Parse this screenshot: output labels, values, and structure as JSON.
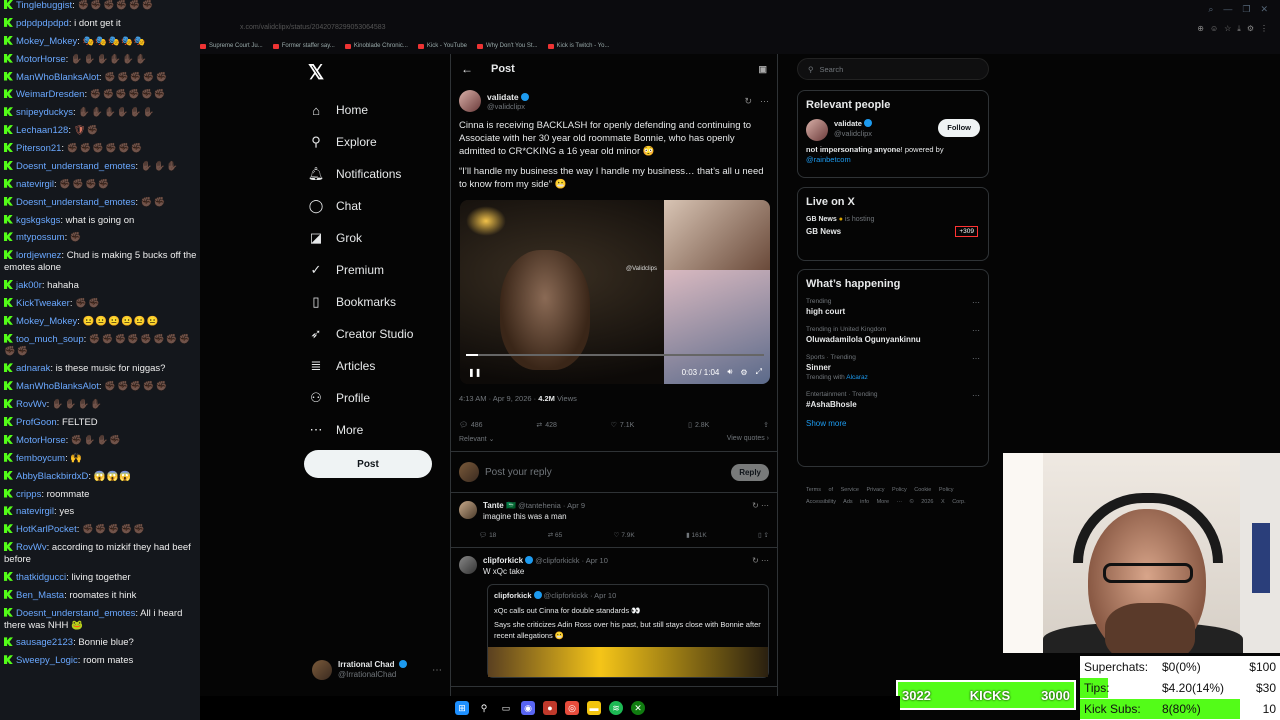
{
  "chat": {
    "messages": [
      {
        "user": "Tinglebuggist",
        "text": "",
        "emotes": "✊🏿✊🏿✊🏿✊🏿✊🏿✊🏿"
      },
      {
        "user": "pdpdpdpdpd",
        "text": "i dont get it",
        "emotes": ""
      },
      {
        "user": "Mokey_Mokey",
        "text": "",
        "emotes": "🎭🎭🎭🎭🎭"
      },
      {
        "user": "MotorHorse",
        "text": "",
        "emotes": "✋🏿✋🏿✋🏿✋🏿✋🏿✋🏿"
      },
      {
        "user": "ManWhoBlanksAlot",
        "text": "",
        "emotes": "✊🏿✊🏿✊🏿✊🏿✊🏿"
      },
      {
        "user": "WeimarDresden",
        "text": "",
        "emotes": "✊🏿✊🏿✊🏿✊🏿✊🏿✊🏿"
      },
      {
        "user": "snipeyduckys",
        "text": "",
        "emotes": "✋🏿✋🏿✋🏿✋🏿✋🏿✋🏿"
      },
      {
        "user": "Lechaan128",
        "text": "",
        "emotes": "🛡✊🏿"
      },
      {
        "user": "Piterson21",
        "text": "",
        "emotes": "✊🏿✊🏿✊🏿✊🏿✊🏿✊🏿"
      },
      {
        "user": "Doesnt_understand_emotes",
        "text": "",
        "emotes": "✋🏿✋🏿✋🏿"
      },
      {
        "user": "natevirgil",
        "text": "",
        "emotes": "✊🏿✊🏿✊🏿✊🏿"
      },
      {
        "user": "Doesnt_understand_emotes",
        "text": "",
        "emotes": "✊🏿✊🏿"
      },
      {
        "user": "kgskgskgs",
        "text": "what is going on",
        "emotes": ""
      },
      {
        "user": "mtypossum",
        "text": "",
        "emotes": "✊🏿"
      },
      {
        "user": "lordjewnez",
        "text": "Chud is making 5 bucks off the emotes alone",
        "emotes": ""
      },
      {
        "user": "jak00r",
        "text": "hahaha",
        "emotes": ""
      },
      {
        "user": "KickTweaker",
        "text": "",
        "emotes": "✊🏿✊🏿"
      },
      {
        "user": "Mokey_Mokey",
        "text": "",
        "emotes": "😐😐😐😐😐😐"
      },
      {
        "user": "too_much_soup",
        "text": "",
        "emotes": "✊🏿✊🏿✊🏿✊🏿✊🏿✊🏿✊🏿✊🏿✊🏿✊🏿"
      },
      {
        "user": "adnarak",
        "text": "is these music for niggas?",
        "emotes": ""
      },
      {
        "user": "ManWhoBlanksAlot",
        "text": "",
        "emotes": "✊🏿✊🏿✊🏿✊🏿✊🏿"
      },
      {
        "user": "RovWv",
        "text": "",
        "emotes": "✋🏿✋🏿✋🏿✋🏿"
      },
      {
        "user": "ProfGoon",
        "text": "FELTED",
        "emotes": ""
      },
      {
        "user": "MotorHorse",
        "text": "",
        "emotes": "✊🏿✋🏿✋🏿✊🏿"
      },
      {
        "user": "femboycum",
        "text": "",
        "emotes": "🙌"
      },
      {
        "user": "AbbyBlackbirdxD",
        "text": "",
        "emotes": "😱😱😱"
      },
      {
        "user": "cripps",
        "text": "roommate",
        "emotes": ""
      },
      {
        "user": "natevirgil",
        "text": "yes",
        "emotes": ""
      },
      {
        "user": "HotKarlPocket",
        "text": "",
        "emotes": "✊🏿✊🏿✊🏿✊🏿✊🏿"
      },
      {
        "user": "RovWv",
        "text": "according to mizkif they had beef before",
        "emotes": ""
      },
      {
        "user": "thatkidgucci",
        "text": "living together",
        "emotes": ""
      },
      {
        "user": "Ben_Masta",
        "text": "roomates it hink",
        "emotes": ""
      },
      {
        "user": "Doesnt_understand_emotes",
        "text": "All i heard there was NHH",
        "emotes": "🐸"
      },
      {
        "user": "sausage2123",
        "text": "Bonnie blue?",
        "emotes": ""
      },
      {
        "user": "Sweepy_Logic",
        "text": "room mates",
        "emotes": ""
      }
    ]
  },
  "browser": {
    "url": "x.com/validclipx/status/2042078299053064583",
    "bookmarks": [
      "Supreme Court Ju...",
      "Former staffer say...",
      "Kinoblade Chronic...",
      "Kick - YouTube",
      "Why Don't You St...",
      "Kick is Twitch - Yo..."
    ]
  },
  "nav": {
    "logo": "𝕏",
    "items": [
      {
        "label": "Home",
        "icon": "⌂",
        "name": "home"
      },
      {
        "label": "Explore",
        "icon": "⚲",
        "name": "explore"
      },
      {
        "label": "Notifications",
        "icon": "🔔︎",
        "name": "notifications"
      },
      {
        "label": "Chat",
        "icon": "◯",
        "name": "chat"
      },
      {
        "label": "Grok",
        "icon": "◪",
        "name": "grok"
      },
      {
        "label": "Premium",
        "icon": "✓",
        "name": "premium"
      },
      {
        "label": "Bookmarks",
        "icon": "▯",
        "name": "bookmarks"
      },
      {
        "label": "Creator Studio",
        "icon": "➶",
        "name": "creator-studio"
      },
      {
        "label": "Articles",
        "icon": "≣",
        "name": "articles"
      },
      {
        "label": "Profile",
        "icon": "⚇",
        "name": "profile"
      },
      {
        "label": "More",
        "icon": "⋯",
        "name": "more"
      }
    ],
    "post_label": "Post",
    "account_name": "Irrational Chad",
    "account_handle": "@IrrationalChad"
  },
  "post": {
    "header": "Post",
    "author_name": "validate",
    "author_handle": "@validclipx",
    "para1": "Cinna is receiving BACKLASH for openly defending and continuing to Associate with her 30 year old roommate Bonnie, who has openly admitted to CR*CKING a 16 year old minor 😳",
    "para2": "“I’ll handle my business the way I handle my business… that’s all u need to know from my side” 😬",
    "watermark": "@Validclips",
    "video_time": "0:03 / 1:04",
    "video_progress": 0.04,
    "timestamp": "4:13 AM · Apr 9, 2026 ·",
    "views_count": "4.2M",
    "views_label": "Views",
    "replies": "486",
    "reposts": "428",
    "likes": "7.1K",
    "bookmarks": "2.8K",
    "relevant": "Relevant ⌄",
    "view_quotes": "View quotes ›",
    "reply_placeholder": "Post your reply",
    "reply_button": "Reply"
  },
  "comments": [
    {
      "name": "Tante 🇸🇦",
      "handle": "@tantehenia · Apr 9",
      "text": "imagine this was a man",
      "replies": "18",
      "reposts": "65",
      "likes": "7.9K",
      "views": "161K"
    },
    {
      "name": "clipforkick",
      "handle": "@clipforkickk · Apr 10",
      "text": "W xQc take",
      "quote_name": "clipforkick",
      "quote_handle": "@clipforkickk · Apr 10",
      "quote_text1": "xQc calls out Cinna for double standards 👀",
      "quote_text2": "Says she criticizes Adin Ross over his past, but still stays close with Bonnie after recent allegations 😬"
    }
  ],
  "right": {
    "search_placeholder": "Search",
    "relevant_title": "Relevant people",
    "rp_name": "validate",
    "rp_handle": "@validclipx",
    "follow": "Follow",
    "rp_bio": "𝐧𝐨𝐭 𝐢𝐦𝐩𝐞𝐫𝐬𝐨𝐧𝐚𝐭𝐢𝐧𝐠 𝐚𝐧𝐲𝐨𝐧𝐞! powered by",
    "rp_link": "@rainbetcom",
    "live_title": "Live on X",
    "live_host": "GB News",
    "live_hosting": "is hosting",
    "live_show": "GB News",
    "live_count": "+309",
    "happening_title": "What’s happening",
    "trends": [
      {
        "cat": "Trending",
        "name": "high court",
        "with": "",
        "with_link": ""
      },
      {
        "cat": "Trending in United Kingdom",
        "name": "Oluwadamilola Ogunyankinnu",
        "with": "",
        "with_link": ""
      },
      {
        "cat": "Sports · Trending",
        "name": "Sinner",
        "with": "Trending with",
        "with_link": "Alcaraz"
      },
      {
        "cat": "Entertainment · Trending",
        "name": "#AshaBhosle",
        "with": "",
        "with_link": ""
      }
    ],
    "show_more": "Show more",
    "footer": "Terms of Service  Privacy Policy  Cookie Policy  Accessibility  Ads info  More ···  © 2026 X Corp."
  },
  "overlay": {
    "kicks_count": "3022",
    "kicks_label": "KICKS",
    "kicks_goal": "3000",
    "superchats_label": "Superchats:",
    "superchats_value": "$0(0%)",
    "superchats_goal": "$100",
    "superchats_progress": 0,
    "tips_label": "Tips:",
    "tips_value": "$4.20(14%)",
    "tips_goal": "$30",
    "tips_progress": 0.14,
    "subs_label": "Kick Subs:",
    "subs_value": "8(80%)",
    "subs_goal": "10",
    "subs_progress": 0.8
  }
}
